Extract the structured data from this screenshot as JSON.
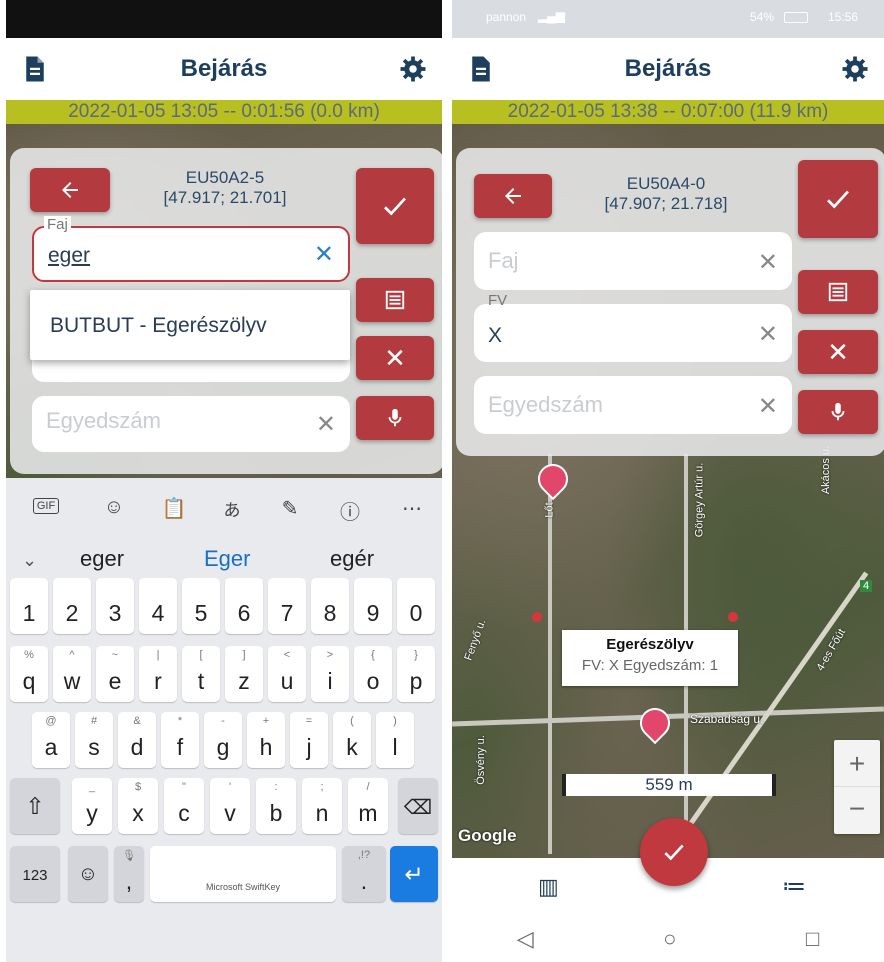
{
  "left": {
    "header": {
      "title": "Bejárás"
    },
    "track": {
      "text": "2022-01-05 13:05 -- 0:01:56 (0.0 km)"
    },
    "form": {
      "id": "EU50A2-5",
      "coords": "[47.917; 21.701]",
      "faj_label": "Faj",
      "faj_value": "eger",
      "suggestion": "BUTBUT - Egerészölyv",
      "egyedszam_placeholder": "Egyedszám"
    },
    "keyboard": {
      "suggestions": [
        "eger",
        "Eger",
        "egér"
      ],
      "row_numbers": [
        "1",
        "2",
        "3",
        "4",
        "5",
        "6",
        "7",
        "8",
        "9",
        "0"
      ],
      "row1": [
        [
          "q",
          "%"
        ],
        [
          "w",
          "^"
        ],
        [
          "e",
          "~"
        ],
        [
          "r",
          "|"
        ],
        [
          "t",
          "["
        ],
        [
          "z",
          "]"
        ],
        [
          "u",
          "<"
        ],
        [
          "i",
          ">"
        ],
        [
          "o",
          "{"
        ],
        [
          "p",
          "}"
        ]
      ],
      "row2": [
        [
          "a",
          "@"
        ],
        [
          "s",
          "#"
        ],
        [
          "d",
          "&"
        ],
        [
          "f",
          "*"
        ],
        [
          "g",
          "-"
        ],
        [
          "h",
          "+"
        ],
        [
          "j",
          "="
        ],
        [
          "k",
          "("
        ],
        [
          "l",
          ")"
        ]
      ],
      "row3": [
        [
          "y",
          "_"
        ],
        [
          "x",
          "$"
        ],
        [
          "c",
          "\""
        ],
        [
          "v",
          "'"
        ],
        [
          "b",
          ":"
        ],
        [
          "n",
          ";"
        ],
        [
          "m",
          "/"
        ]
      ],
      "key_123": "123",
      "space_label": "Microsoft SwiftKey",
      "period": ".",
      "comma": ",",
      "punct_hint": ",!?",
      "gif": "GIF"
    }
  },
  "right": {
    "status": {
      "carrier": "pannon",
      "battery": "54%",
      "time": "15:56"
    },
    "header": {
      "title": "Bejárás"
    },
    "track": {
      "text": "2022-01-05 13:38 -- 0:07:00 (11.9 km)"
    },
    "form": {
      "id": "EU50A4-0",
      "coords": "[47.907; 21.718]",
      "faj_placeholder": "Faj",
      "fv_label": "FV",
      "fv_value": "X",
      "egyedszam_placeholder": "Egyedszám"
    },
    "map": {
      "popup_title": "Egerészölyv",
      "popup_sub": "FV: X Egyedszám: 1",
      "scale": "559 m",
      "google": "Google",
      "streets": [
        "Görgey Artúr u.",
        "Akácos u.",
        "Szabadság u.",
        "Fenyő u.",
        "Ösvény u.",
        "4-es Főút",
        "Lőt",
        "4"
      ],
      "zoom_in": "+",
      "zoom_out": "−"
    }
  }
}
